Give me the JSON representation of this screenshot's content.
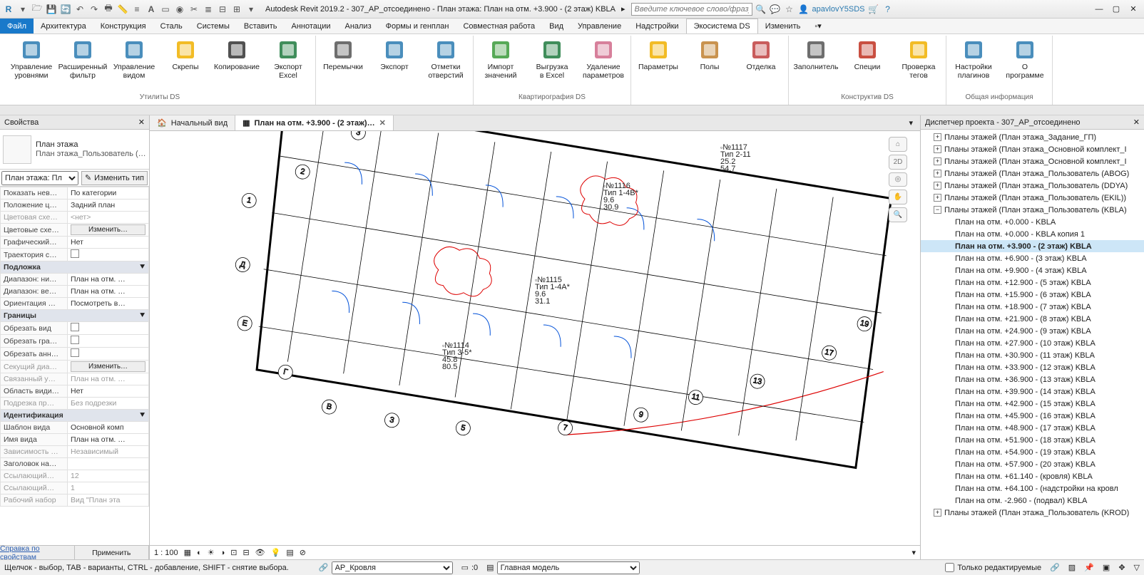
{
  "titlebar": {
    "app_title": "Autodesk Revit 2019.2 - 307_АР_отсоединено - План этажа: План на отм. +3.900 - (2 этаж) KBLA",
    "search_placeholder": "Введите ключевое слово/фразу",
    "user": "apavlovY5SDS"
  },
  "menubar": {
    "file": "Файл",
    "items": [
      "Архитектура",
      "Конструкция",
      "Сталь",
      "Системы",
      "Вставить",
      "Аннотации",
      "Анализ",
      "Формы и генплан",
      "Совместная работа",
      "Вид",
      "Управление",
      "Надстройки",
      "Экосистема DS",
      "Изменить"
    ]
  },
  "ribbon": {
    "groups": [
      {
        "label": "Утилиты DS",
        "buttons": [
          {
            "text": "Управление уровнями",
            "name": "manage-levels"
          },
          {
            "text": "Расширенный фильтр",
            "name": "advanced-filter"
          },
          {
            "text": "Управление видом",
            "name": "manage-view"
          },
          {
            "text": "Скрепы",
            "name": "clips"
          },
          {
            "text": "Копирование",
            "name": "copying"
          },
          {
            "text": "Экспорт Excel",
            "name": "export-excel"
          }
        ]
      },
      {
        "label": "",
        "buttons": [
          {
            "text": "Перемычки",
            "name": "lintels"
          },
          {
            "text": "Экспорт",
            "name": "export-pdf"
          },
          {
            "text": "Отметки отверстий",
            "name": "opening-marks"
          }
        ]
      },
      {
        "label": "Квартирография DS",
        "buttons": [
          {
            "text": "Импорт значений",
            "name": "import-values"
          },
          {
            "text": "Выгрузка в Excel",
            "name": "upload-excel"
          },
          {
            "text": "Удаление параметров",
            "name": "delete-params"
          }
        ]
      },
      {
        "label": "",
        "buttons": [
          {
            "text": "Параметры",
            "name": "parameters"
          },
          {
            "text": "Полы",
            "name": "floors"
          },
          {
            "text": "Отделка",
            "name": "finish"
          }
        ]
      },
      {
        "label": "Конструктив DS",
        "buttons": [
          {
            "text": "Заполнитель",
            "name": "filler"
          },
          {
            "text": "Специи",
            "name": "spices"
          },
          {
            "text": "Проверка тегов",
            "name": "check-tags"
          }
        ]
      },
      {
        "label": "Общая информация",
        "buttons": [
          {
            "text": "Настройки плагинов",
            "name": "plugin-settings"
          },
          {
            "text": "О программе",
            "name": "about"
          }
        ]
      }
    ]
  },
  "viewtabs": {
    "tab1": "Начальный вид",
    "tab2": "План на отм. +3.900 - (2 этаж)…"
  },
  "properties": {
    "title": "Свойства",
    "type_family": "План этажа",
    "type_name": "План этажа_Пользователь (…",
    "instance_label": "План этажа: Пл",
    "edit_type": "Изменить тип",
    "cats": {
      "underlay": "Подложка",
      "extents": "Границы",
      "identity": "Идентификация"
    },
    "rows": [
      {
        "k": "Показать нев…",
        "v": "По категории"
      },
      {
        "k": "Положение ц…",
        "v": "Задний план"
      },
      {
        "k": "Цветовая схе…",
        "v": "<нет>",
        "dim": true
      },
      {
        "k": "Цветовые схе…",
        "v": "Изменить…",
        "btn": true
      },
      {
        "k": "Графический…",
        "v": "Нет"
      },
      {
        "k": "Траектория с…",
        "v": "",
        "chk": true
      }
    ],
    "rows2": [
      {
        "k": "Диапазон: ни…",
        "v": "План на отм. …"
      },
      {
        "k": "Диапазон: ве…",
        "v": "План на отм. …"
      },
      {
        "k": "Ориентация …",
        "v": "Посмотреть в…"
      }
    ],
    "rows3": [
      {
        "k": "Обрезать вид",
        "v": "",
        "chk": true
      },
      {
        "k": "Обрезать гра…",
        "v": "",
        "chk": true
      },
      {
        "k": "Обрезать анн…",
        "v": "",
        "chk": true
      },
      {
        "k": "Секущий диа…",
        "v": "Изменить…",
        "dim": true,
        "btn": true
      },
      {
        "k": "Связанный у…",
        "v": "План на отм. …",
        "dim": true
      },
      {
        "k": "Область види…",
        "v": "Нет"
      },
      {
        "k": "Подрезка пр…",
        "v": "Без подрезки",
        "dim": true
      }
    ],
    "rows4": [
      {
        "k": "Шаблон вида",
        "v": "Основной комп"
      },
      {
        "k": "Имя вида",
        "v": "План на отм. …"
      },
      {
        "k": "Зависимость …",
        "v": "Независимый",
        "dim": true
      },
      {
        "k": "Заголовок на…",
        "v": ""
      },
      {
        "k": "Ссылающий…",
        "v": "12",
        "dim": true
      },
      {
        "k": "Ссылающий…",
        "v": "1",
        "dim": true
      },
      {
        "k": "Рабочий набор",
        "v": "Вид \"План эта",
        "dim": true
      }
    ],
    "help": "Справка по свойствам",
    "apply": "Применить"
  },
  "browser": {
    "title": "Диспетчер проекта - 307_АР_отсоединено",
    "groups": [
      "Планы этажей (План этажа_Задание_ГП)",
      "Планы этажей (План этажа_Основной комплект_І",
      "Планы этажей (План этажа_Основной комплект_І",
      "Планы этажей (План этажа_Пользователь (ABOG)",
      "Планы этажей (План этажа_Пользователь (DDYA)",
      "Планы этажей (План этажа_Пользователь (EKIL))",
      "Планы этажей (План этажа_Пользователь (KBLA)"
    ],
    "views": [
      "План на отм. +0.000 - KBLA",
      "План на отм. +0.000 - KBLA копия 1",
      "План на отм. +3.900 - (2 этаж) KBLA",
      "План на отм. +6.900 - (3 этаж) KBLA",
      "План на отм. +9.900 - (4 этаж) KBLA",
      "План на отм. +12.900 - (5 этаж) KBLA",
      "План на отм. +15.900 - (6 этаж) KBLA",
      "План на отм. +18.900 - (7 этаж) KBLA",
      "План на отм. +21.900 - (8 этаж) KBLA",
      "План на отм. +24.900 - (9 этаж) KBLA",
      "План на отм. +27.900 - (10 этаж) KBLA",
      "План на отм. +30.900 - (11 этаж) KBLA",
      "План на отм. +33.900 - (12 этаж) KBLA",
      "План на отм. +36.900 - (13 этаж) KBLA",
      "План на отм. +39.900 - (14 этаж) KBLA",
      "План на отм. +42.900 - (15 этаж) KBLA",
      "План на отм. +45.900 - (16 этаж) KBLA",
      "План на отм. +48.900 - (17 этаж) KBLA",
      "План на отм. +51.900 - (18 этаж) KBLA",
      "План на отм. +54.900 - (19 этаж) KBLA",
      "План на отм. +57.900 - (20 этаж) KBLA",
      "План на отм. +61.140 - (кровля) KBLA",
      "План на отм. +64.100 - (надстройки на кровл",
      "План на отм. -2.960 - (подвал) KBLA"
    ],
    "last": "Планы этажей (План этажа_Пользователь (KROD)",
    "selected_index": 2
  },
  "viewcontrol": {
    "scale": "1 : 100"
  },
  "status": {
    "hint": "Щелчок - выбор, TAB - варианты, CTRL - добавление, SHIFT - снятие выбора.",
    "workset": "АР_Кровля",
    "count": ":0",
    "model": "Главная модель",
    "editable_only": "Только редактируемые"
  },
  "drawing_labels": {
    "n1117": "№1117",
    "t211": "Тип 2-11",
    "v252": "25.2",
    "v547": "54.7",
    "n1116": "№1116",
    "t14b": "Тип 1-4В*",
    "v96": "9.6",
    "v309": "30.9",
    "n1115": "№1115",
    "t14a": "Тип 1-4А*",
    "v96b": "9.6",
    "v311": "31.1",
    "n1114": "№1114",
    "t35": "Тип 3-5*",
    "v458": "45.8",
    "v805": "80.5"
  }
}
